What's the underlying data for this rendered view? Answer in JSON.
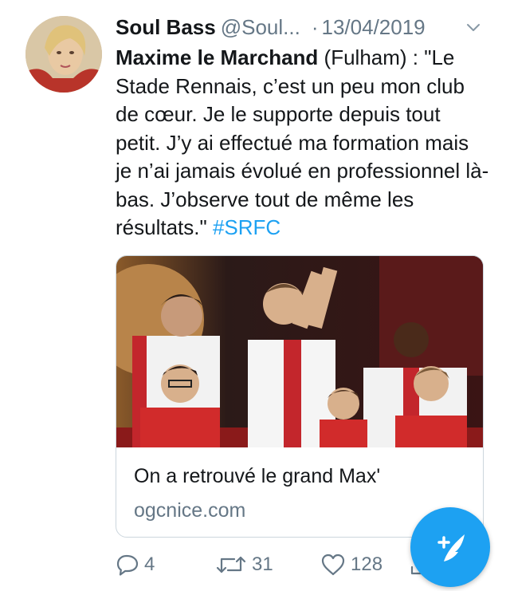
{
  "tweet": {
    "author_name": "Soul Bass",
    "author_handle": "@Soul...",
    "separator": "·",
    "date": "13/04/2019",
    "text_bold": "Maxime le Marchand",
    "text_after_bold": " (Fulham) : \"Le Stade Rennais, c’est un peu mon club de cœur. Je le supporte depuis tout petit. J’y ai effectué ma formation mais je n’ai jamais évolué en professionnel là-bas. J’observe tout de même les résultats.\" ",
    "hashtag": "#SRFC"
  },
  "card": {
    "title": "On a retrouvé le grand Max'",
    "domain": "ogcnice.com"
  },
  "actions": {
    "replies": "4",
    "retweets": "31",
    "likes": "128"
  },
  "icons": {
    "caret": "chevron-down-icon",
    "reply": "reply-icon",
    "retweet": "retweet-icon",
    "like": "heart-icon",
    "share": "share-icon",
    "compose": "compose-tweet-icon"
  },
  "colors": {
    "accent": "#1da1f2",
    "text": "#14171a",
    "muted": "#657786"
  }
}
